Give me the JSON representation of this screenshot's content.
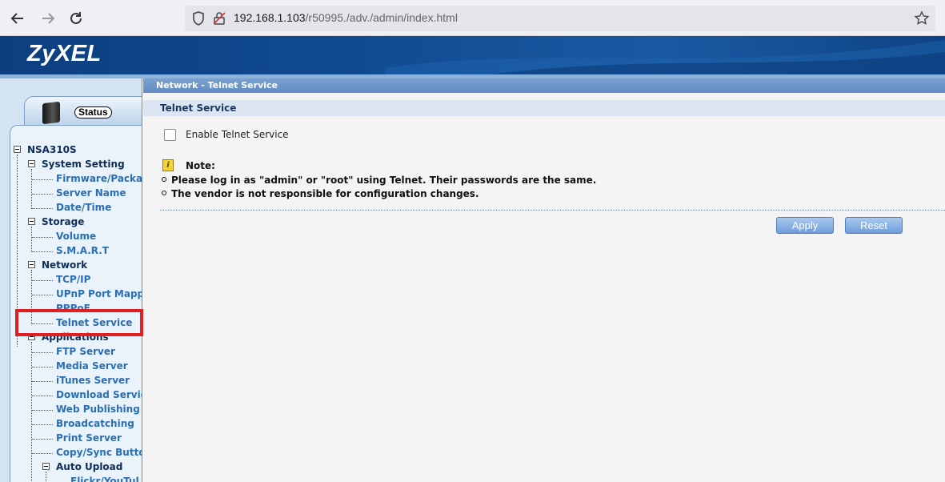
{
  "browser": {
    "url_host": "192.168.1.103",
    "url_path": "/r50995./adv./admin/index.html"
  },
  "brand": {
    "logo_text": "ZyXEL"
  },
  "sidebar": {
    "status_label": "Status",
    "root": "NSA310S",
    "groups": [
      {
        "label": "System Setting",
        "items": [
          "Firmware/Packa",
          "Server Name",
          "Date/Time"
        ]
      },
      {
        "label": "Storage",
        "items": [
          "Volume",
          "S.M.A.R.T"
        ]
      },
      {
        "label": "Network",
        "items": [
          "TCP/IP",
          "UPnP Port Mappi",
          "PPPoE",
          "Telnet Service"
        ]
      },
      {
        "label": "Applications",
        "items": [
          "FTP Server",
          "Media Server",
          "iTunes Server",
          "Download Servic",
          "Web Publishing",
          "Broadcatching",
          "Print Server",
          "Copy/Sync Butto"
        ]
      }
    ],
    "auto_upload": {
      "label": "Auto Upload",
      "items": [
        "Flickr/YouTul"
      ]
    }
  },
  "main": {
    "breadcrumb": "Network - Telnet Service",
    "section_title": "Telnet Service",
    "checkbox_label": "Enable Telnet Service",
    "checkbox_checked": false,
    "note_title": "Note:",
    "note_icon_glyph": "i",
    "notes": [
      "Please log in as \"admin\" or \"root\" using Telnet. Their passwords are the same.",
      "The vendor is not responsible for configuration changes."
    ],
    "apply_label": "Apply",
    "reset_label": "Reset"
  },
  "colors": {
    "header_blue": "#114b92",
    "highlight_red": "#e02020",
    "button_blue": "#6f9ddb"
  }
}
